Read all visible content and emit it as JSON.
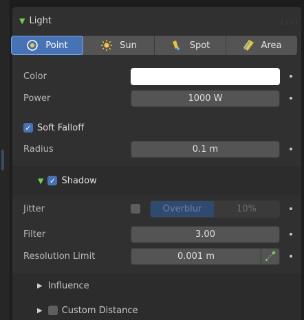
{
  "panel": {
    "title": "Light"
  },
  "light_types": [
    {
      "label": "Point",
      "icon": "point-light-icon",
      "active": true
    },
    {
      "label": "Sun",
      "icon": "sun-icon",
      "active": false
    },
    {
      "label": "Spot",
      "icon": "spot-light-icon",
      "active": false
    },
    {
      "label": "Area",
      "icon": "area-light-icon",
      "active": false
    }
  ],
  "color": {
    "label": "Color",
    "value": "#ffffff"
  },
  "power": {
    "label": "Power",
    "value": "1000 W"
  },
  "soft_falloff": {
    "label": "Soft Falloff",
    "checked": true
  },
  "radius": {
    "label": "Radius",
    "value": "0.1 m"
  },
  "shadow": {
    "label": "Shadow",
    "checked": true,
    "expanded": true
  },
  "jitter": {
    "label": "Jitter",
    "checked": false,
    "overblur_label": "Overblur",
    "overblur_value": "10%"
  },
  "filter": {
    "label": "Filter",
    "value": "3.00"
  },
  "resolution_limit": {
    "label": "Resolution Limit",
    "value": "0.001 m"
  },
  "influence": {
    "label": "Influence",
    "expanded": false
  },
  "custom_distance": {
    "label": "Custom Distance",
    "checked": false,
    "expanded": false
  },
  "colors": {
    "accent": "#4772b3",
    "expand_arrow": "#6ed34a",
    "panel_bg": "#303030",
    "field_bg": "#545454"
  }
}
